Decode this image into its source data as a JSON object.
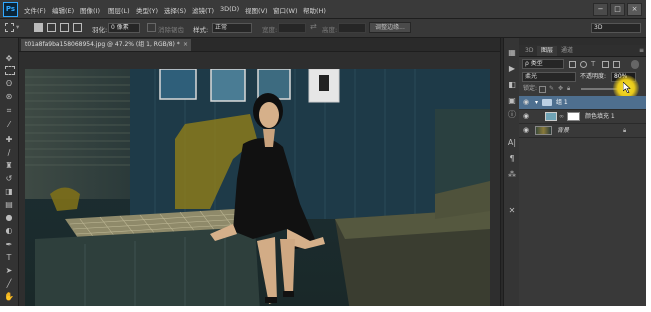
{
  "app": {
    "logo": "Ps"
  },
  "menu": [
    "文件(F)",
    "编辑(E)",
    "图像(I)",
    "图层(L)",
    "类型(Y)",
    "选择(S)",
    "滤镜(T)",
    "3D(D)",
    "视图(V)",
    "窗口(W)",
    "帮助(H)"
  ],
  "window_buttons": [
    "−",
    "□",
    "×"
  ],
  "options_bar": {
    "feather_label": "羽化:",
    "feather_value": "0 像素",
    "antialias_label": "消除锯齿",
    "style_label": "样式:",
    "style_value": "正常",
    "width_label": "宽度:",
    "height_label": "高度:",
    "refine_edge_button": "调整边缘...",
    "workspace_value": "3D"
  },
  "document_tab": {
    "title": "t01a8fa9ba158068954.jpg @ 47.2% (组 1, RGB/8) *",
    "close": "×"
  },
  "panel": {
    "tabs": [
      "3D",
      "图层",
      "通道"
    ],
    "active_tab": "图层",
    "filter_label": "ρ 类型",
    "blend_mode": "柔光",
    "opacity_label": "不透明度:",
    "opacity_value": "80%",
    "lock_label": "锁定:",
    "layers": [
      {
        "name": "组 1",
        "kind": "group",
        "visible": true
      },
      {
        "name": "颜色填充 1",
        "kind": "fill",
        "visible": true
      },
      {
        "name": "背景",
        "kind": "background",
        "visible": true
      }
    ]
  },
  "colors": {
    "accent": "#31a8ff",
    "highlight": "#f2da2a",
    "panel_bg": "#393939",
    "app_bg": "#2c2c2c"
  }
}
